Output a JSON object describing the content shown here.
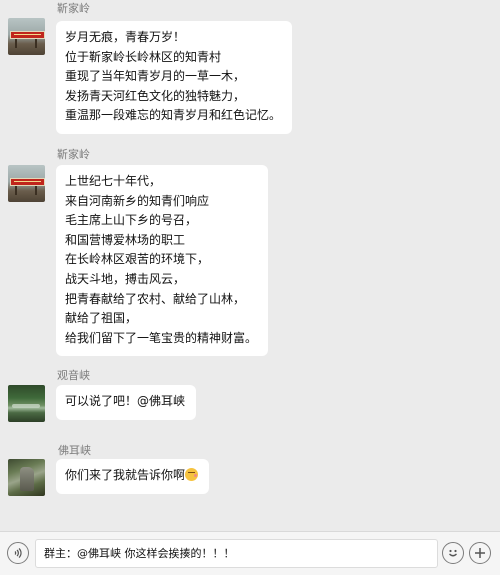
{
  "messages": [
    {
      "sender": "靳家岭",
      "lines": [
        "岁月无痕，青春万岁！",
        "位于靳家岭长岭林区的知青村",
        "重现了当年知青岁月的一草一木，",
        "发扬青天河红色文化的独特魅力，",
        "重温那一段难忘的知青岁月和红色记忆。"
      ]
    },
    {
      "sender": "靳家岭",
      "lines": [
        "上世纪七十年代，",
        "来自河南新乡的知青们响应",
        "毛主席上山下乡的号召，",
        "和国营博爱林场的职工",
        "在长岭林区艰苦的环境下，",
        "战天斗地，搏击风云，",
        "把青春献给了农村、献给了山林，",
        "献给了祖国，",
        "给我们留下了一笔宝贵的精神财富。"
      ]
    },
    {
      "sender": "观音峡",
      "lines": [
        "可以说了吧！@佛耳峡"
      ]
    },
    {
      "sender": "佛耳峡",
      "lines": [
        "你们来了我就告诉你啊"
      ],
      "trailing_icon": "blushing-emoji-icon"
    }
  ],
  "input": {
    "value": "群主：@佛耳峡 你这样会挨揍的！！！"
  },
  "icons": {
    "voice": "voice-icon",
    "emoji": "smiley-icon",
    "add": "plus-icon"
  },
  "colors": {
    "background": "#ebebeb",
    "bubble": "#ffffff",
    "sender_text": "#7d7d7d",
    "input_bar": "#f5f5f5"
  }
}
